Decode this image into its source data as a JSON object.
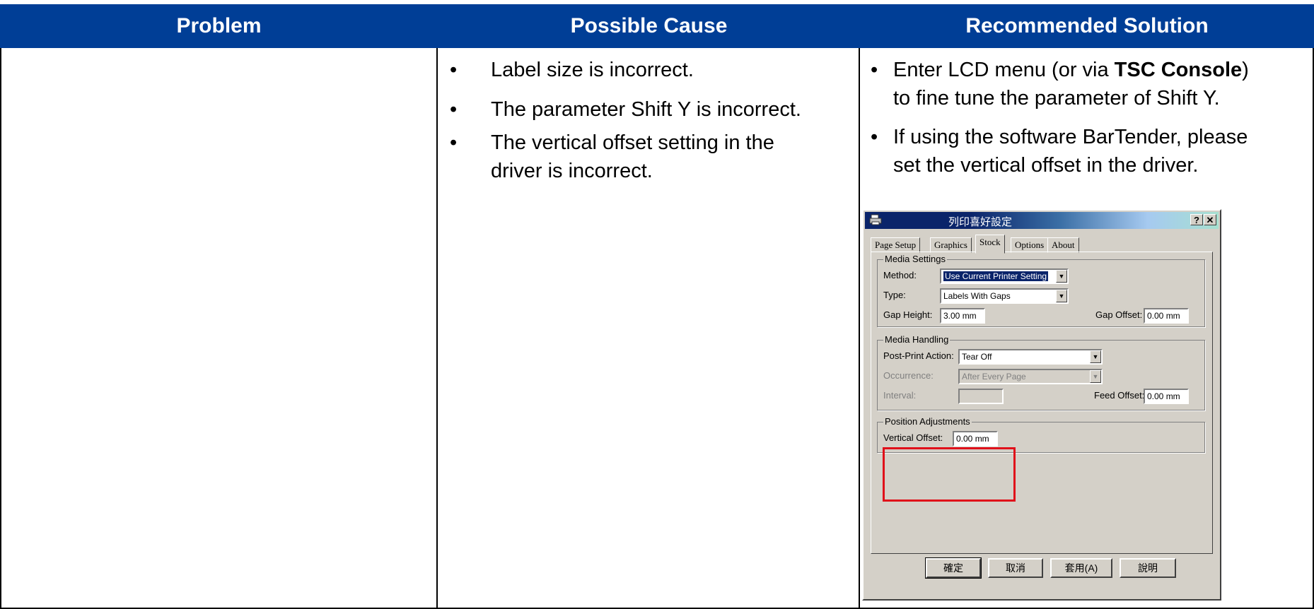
{
  "table": {
    "headers": [
      "Problem",
      "Possible Cause",
      "Recommended Solution"
    ],
    "causes": [
      "Label size is incorrect.",
      "The parameter Shift Y is incorrect.",
      "The vertical offset setting in the",
      "driver is incorrect."
    ],
    "solutions": {
      "s1_line1_pre": "Enter LCD menu (or via ",
      "s1_line1_bold": "TSC Console",
      "s1_line1_post": ")",
      "s1_line2": "to fine tune the parameter of Shift Y.",
      "s2_line1": "If using the software BarTender, please",
      "s2_line2": "set the vertical offset in the driver."
    },
    "bullet": "•"
  },
  "dialog": {
    "title": "列印喜好設定",
    "help_btn": "?",
    "close_btn": "✕",
    "tabs": [
      "Page Setup",
      "Graphics",
      "Stock",
      "Options",
      "About"
    ],
    "media_settings": {
      "caption": "Media Settings",
      "method_label": "Method:",
      "method_value": "Use Current Printer Setting",
      "type_label": "Type:",
      "type_value": "Labels With Gaps",
      "gap_height_label": "Gap Height:",
      "gap_height_value": "3.00 mm",
      "gap_offset_label": "Gap Offset:",
      "gap_offset_value": "0.00 mm"
    },
    "media_handling": {
      "caption": "Media Handling",
      "post_print_label": "Post-Print Action:",
      "post_print_value": "Tear Off",
      "occurrence_label": "Occurrence:",
      "occurrence_value": "After Every Page",
      "interval_label": "Interval:",
      "interval_value": "",
      "feed_offset_label": "Feed Offset:",
      "feed_offset_value": "0.00 mm"
    },
    "position_adjustments": {
      "caption": "Position Adjustments",
      "vertical_offset_label": "Vertical Offset:",
      "vertical_offset_value": "0.00 mm"
    },
    "buttons": [
      "確定",
      "取消",
      "套用(A)",
      "說明"
    ]
  },
  "colors": {
    "header_bg": "#003e96",
    "highlight_box": "#e0101a"
  }
}
